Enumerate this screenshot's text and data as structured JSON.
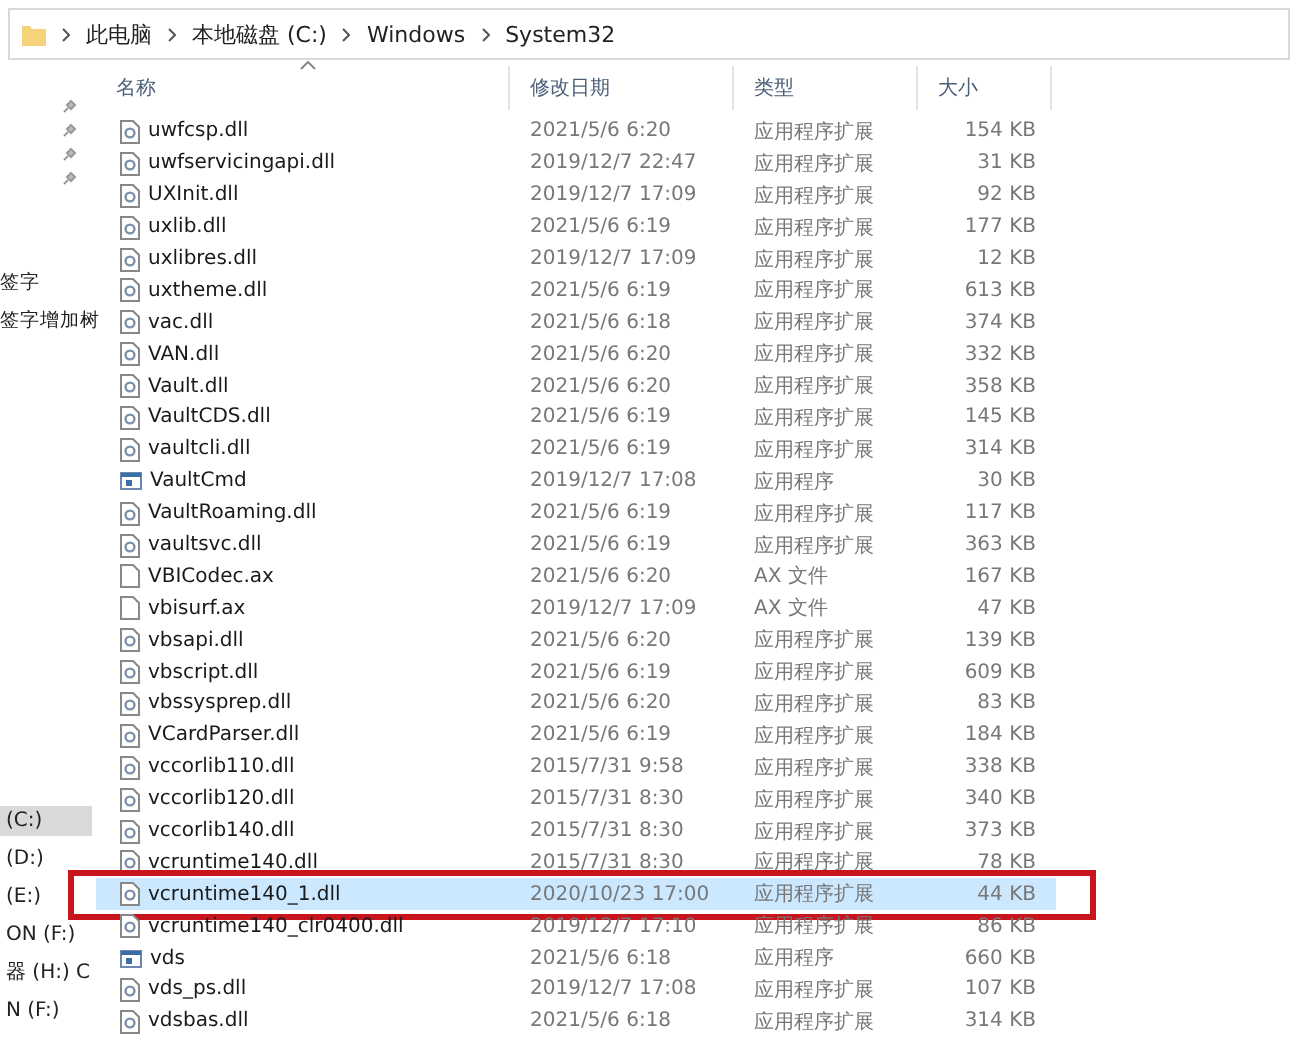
{
  "breadcrumb": [
    "此电脑",
    "本地磁盘 (C:)",
    "Windows",
    "System32"
  ],
  "nav": {
    "labels": [
      "签字",
      "签字增加树"
    ],
    "drives": [
      {
        "label": "(C:)",
        "selected": true
      },
      {
        "label": "(D:)",
        "selected": false
      },
      {
        "label": "(E:)",
        "selected": false
      },
      {
        "label": "ON (F:)",
        "selected": false
      },
      {
        "label": "器 (H:) C",
        "selected": false
      },
      {
        "label": "N (F:)",
        "selected": false
      }
    ]
  },
  "columns": [
    "名称",
    "修改日期",
    "类型",
    "大小"
  ],
  "rows": [
    {
      "kind": "dll",
      "name": "uwfcsp.dll",
      "date": "2021/5/6 6:20",
      "type": "应用程序扩展",
      "size": "154 KB",
      "selected": false,
      "highlighted": false
    },
    {
      "kind": "dll",
      "name": "uwfservicingapi.dll",
      "date": "2019/12/7 22:47",
      "type": "应用程序扩展",
      "size": "31 KB",
      "selected": false,
      "highlighted": false
    },
    {
      "kind": "dll",
      "name": "UXInit.dll",
      "date": "2019/12/7 17:09",
      "type": "应用程序扩展",
      "size": "92 KB",
      "selected": false,
      "highlighted": false
    },
    {
      "kind": "dll",
      "name": "uxlib.dll",
      "date": "2021/5/6 6:19",
      "type": "应用程序扩展",
      "size": "177 KB",
      "selected": false,
      "highlighted": false
    },
    {
      "kind": "dll",
      "name": "uxlibres.dll",
      "date": "2019/12/7 17:09",
      "type": "应用程序扩展",
      "size": "12 KB",
      "selected": false,
      "highlighted": false
    },
    {
      "kind": "dll",
      "name": "uxtheme.dll",
      "date": "2021/5/6 6:19",
      "type": "应用程序扩展",
      "size": "613 KB",
      "selected": false,
      "highlighted": false
    },
    {
      "kind": "dll",
      "name": "vac.dll",
      "date": "2021/5/6 6:18",
      "type": "应用程序扩展",
      "size": "374 KB",
      "selected": false,
      "highlighted": false
    },
    {
      "kind": "dll",
      "name": "VAN.dll",
      "date": "2021/5/6 6:20",
      "type": "应用程序扩展",
      "size": "332 KB",
      "selected": false,
      "highlighted": false
    },
    {
      "kind": "dll",
      "name": "Vault.dll",
      "date": "2021/5/6 6:20",
      "type": "应用程序扩展",
      "size": "358 KB",
      "selected": false,
      "highlighted": false
    },
    {
      "kind": "dll",
      "name": "VaultCDS.dll",
      "date": "2021/5/6 6:19",
      "type": "应用程序扩展",
      "size": "145 KB",
      "selected": false,
      "highlighted": false
    },
    {
      "kind": "dll",
      "name": "vaultcli.dll",
      "date": "2021/5/6 6:19",
      "type": "应用程序扩展",
      "size": "314 KB",
      "selected": false,
      "highlighted": false
    },
    {
      "kind": "app",
      "name": "VaultCmd",
      "date": "2019/12/7 17:08",
      "type": "应用程序",
      "size": "30 KB",
      "selected": false,
      "highlighted": false
    },
    {
      "kind": "dll",
      "name": "VaultRoaming.dll",
      "date": "2021/5/6 6:19",
      "type": "应用程序扩展",
      "size": "117 KB",
      "selected": false,
      "highlighted": false
    },
    {
      "kind": "dll",
      "name": "vaultsvc.dll",
      "date": "2021/5/6 6:19",
      "type": "应用程序扩展",
      "size": "363 KB",
      "selected": false,
      "highlighted": false
    },
    {
      "kind": "ax",
      "name": "VBICodec.ax",
      "date": "2021/5/6 6:20",
      "type": "AX 文件",
      "size": "167 KB",
      "selected": false,
      "highlighted": false
    },
    {
      "kind": "ax",
      "name": "vbisurf.ax",
      "date": "2019/12/7 17:09",
      "type": "AX 文件",
      "size": "47 KB",
      "selected": false,
      "highlighted": false
    },
    {
      "kind": "dll",
      "name": "vbsapi.dll",
      "date": "2021/5/6 6:20",
      "type": "应用程序扩展",
      "size": "139 KB",
      "selected": false,
      "highlighted": false
    },
    {
      "kind": "dll",
      "name": "vbscript.dll",
      "date": "2021/5/6 6:19",
      "type": "应用程序扩展",
      "size": "609 KB",
      "selected": false,
      "highlighted": false
    },
    {
      "kind": "dll",
      "name": "vbssysprep.dll",
      "date": "2021/5/6 6:20",
      "type": "应用程序扩展",
      "size": "83 KB",
      "selected": false,
      "highlighted": false
    },
    {
      "kind": "dll",
      "name": "VCardParser.dll",
      "date": "2021/5/6 6:19",
      "type": "应用程序扩展",
      "size": "184 KB",
      "selected": false,
      "highlighted": false
    },
    {
      "kind": "dll",
      "name": "vccorlib110.dll",
      "date": "2015/7/31 9:58",
      "type": "应用程序扩展",
      "size": "338 KB",
      "selected": false,
      "highlighted": false
    },
    {
      "kind": "dll",
      "name": "vccorlib120.dll",
      "date": "2015/7/31 8:30",
      "type": "应用程序扩展",
      "size": "340 KB",
      "selected": false,
      "highlighted": false
    },
    {
      "kind": "dll",
      "name": "vccorlib140.dll",
      "date": "2015/7/31 8:30",
      "type": "应用程序扩展",
      "size": "373 KB",
      "selected": false,
      "highlighted": false
    },
    {
      "kind": "dll",
      "name": "vcruntime140.dll",
      "date": "2015/7/31 8:30",
      "type": "应用程序扩展",
      "size": "78 KB",
      "selected": false,
      "highlighted": false
    },
    {
      "kind": "dll",
      "name": "vcruntime140_1.dll",
      "date": "2020/10/23 17:00",
      "type": "应用程序扩展",
      "size": "44 KB",
      "selected": true,
      "highlighted": true
    },
    {
      "kind": "dll",
      "name": "vcruntime140_clr0400.dll",
      "date": "2019/12/7 17:10",
      "type": "应用程序扩展",
      "size": "86 KB",
      "selected": false,
      "highlighted": false
    },
    {
      "kind": "app",
      "name": "vds",
      "date": "2021/5/6 6:18",
      "type": "应用程序",
      "size": "660 KB",
      "selected": false,
      "highlighted": false
    },
    {
      "kind": "dll",
      "name": "vds_ps.dll",
      "date": "2019/12/7 17:08",
      "type": "应用程序扩展",
      "size": "107 KB",
      "selected": false,
      "highlighted": false
    },
    {
      "kind": "dll",
      "name": "vdsbas.dll",
      "date": "2021/5/6 6:18",
      "type": "应用程序扩展",
      "size": "314 KB",
      "selected": false,
      "highlighted": false
    }
  ]
}
